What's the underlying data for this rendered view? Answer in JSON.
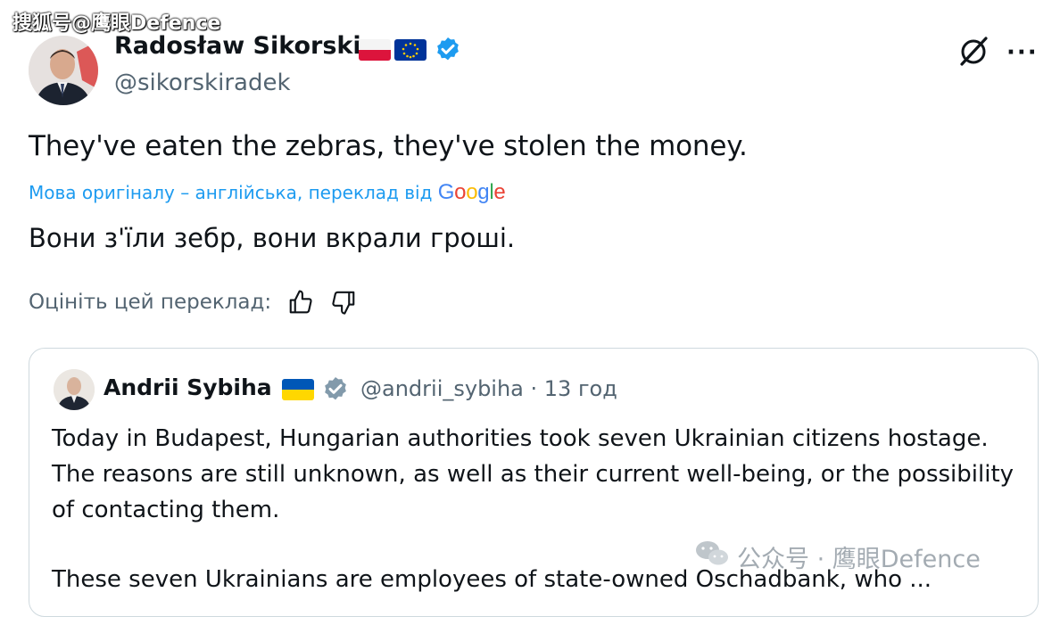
{
  "watermark_top": "搜狐号@鹰眼Defence",
  "post": {
    "author_name": "Radosław Sikorski",
    "handle": "@sikorskiradek",
    "text": "They've eaten the zebras, they've stolen the money.",
    "translated_from": "Мова оригіналу – англійська, переклад від",
    "translator": "Google",
    "translation": "Вони з'їли зебр, вони вкрали гроші.",
    "rate_label": "Оцініть цей переклад:",
    "more_label": "···"
  },
  "quote": {
    "author_name": "Andrii Sybiha",
    "handle_time": "@andrii_sybiha · 13 год",
    "text": "Today in Budapest, Hungarian authorities took seven Ukrainian citizens hostage. The reasons are still unknown, as well as their current well-being, or the possibility of contacting them.",
    "text2": "These seven Ukrainians are employees of state-owned Oschadbank, who ..."
  },
  "watermark_bottom": "公众号 · 鹰眼Defence",
  "colors": {
    "verified": "#1d9bf0",
    "verified_gray": "#829aab",
    "link": "#1d9bf0",
    "secondary_text": "#536471"
  },
  "icons": [
    "grok-icon",
    "more-icon",
    "thumbs-up-icon",
    "thumbs-down-icon",
    "verified-icon",
    "wechat-icon"
  ]
}
